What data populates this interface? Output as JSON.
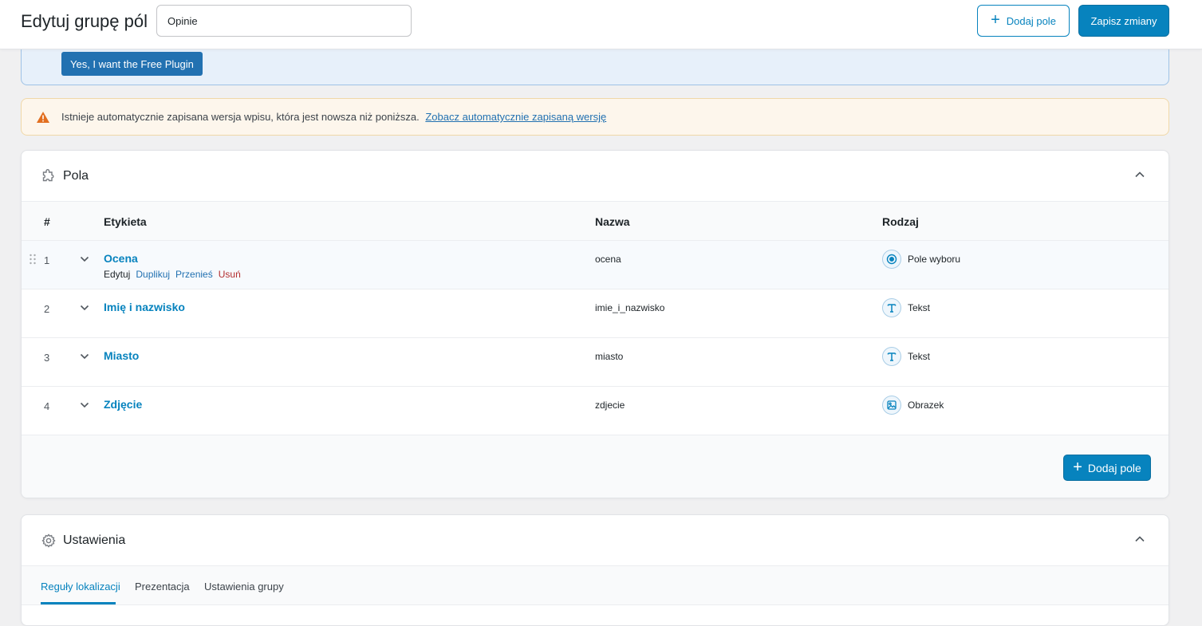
{
  "header": {
    "title": "Edytuj grupę pól",
    "group_name_value": "Opinie",
    "add_field_label": "Dodaj pole",
    "save_label": "Zapisz zmiany"
  },
  "promo": {
    "button_label": "Yes, I want the Free Plugin"
  },
  "autosave_notice": {
    "text": "Istnieje automatycznie zapisana wersja wpisu, która jest nowsza niż poniższa.",
    "link_text": "Zobacz automatycznie zapisaną wersję"
  },
  "fields_panel": {
    "title": "Pola",
    "columns": {
      "num": "#",
      "label": "Etykieta",
      "name": "Nazwa",
      "type": "Rodzaj"
    },
    "row_actions": {
      "edit": "Edytuj",
      "duplicate": "Duplikuj",
      "move": "Przenieś",
      "delete": "Usuń"
    },
    "rows": [
      {
        "num": "1",
        "label": "Ocena",
        "name": "ocena",
        "type": "Pole wyboru",
        "icon": "radio-icon"
      },
      {
        "num": "2",
        "label": "Imię i nazwisko",
        "name": "imie_i_nazwisko",
        "type": "Tekst",
        "icon": "text-icon"
      },
      {
        "num": "3",
        "label": "Miasto",
        "name": "miasto",
        "type": "Tekst",
        "icon": "text-icon"
      },
      {
        "num": "4",
        "label": "Zdjęcie",
        "name": "zdjecie",
        "type": "Obrazek",
        "icon": "image-icon"
      }
    ],
    "add_field_label": "Dodaj pole"
  },
  "settings_panel": {
    "title": "Ustawienia",
    "tabs": [
      {
        "label": "Reguły lokalizacji",
        "active": true
      },
      {
        "label": "Prezentacja",
        "active": false
      },
      {
        "label": "Ustawienia grupy",
        "active": false
      }
    ]
  },
  "colors": {
    "accent": "#0783be",
    "link": "#2271b1",
    "danger": "#b32d2e",
    "warning": "#e26f20"
  }
}
